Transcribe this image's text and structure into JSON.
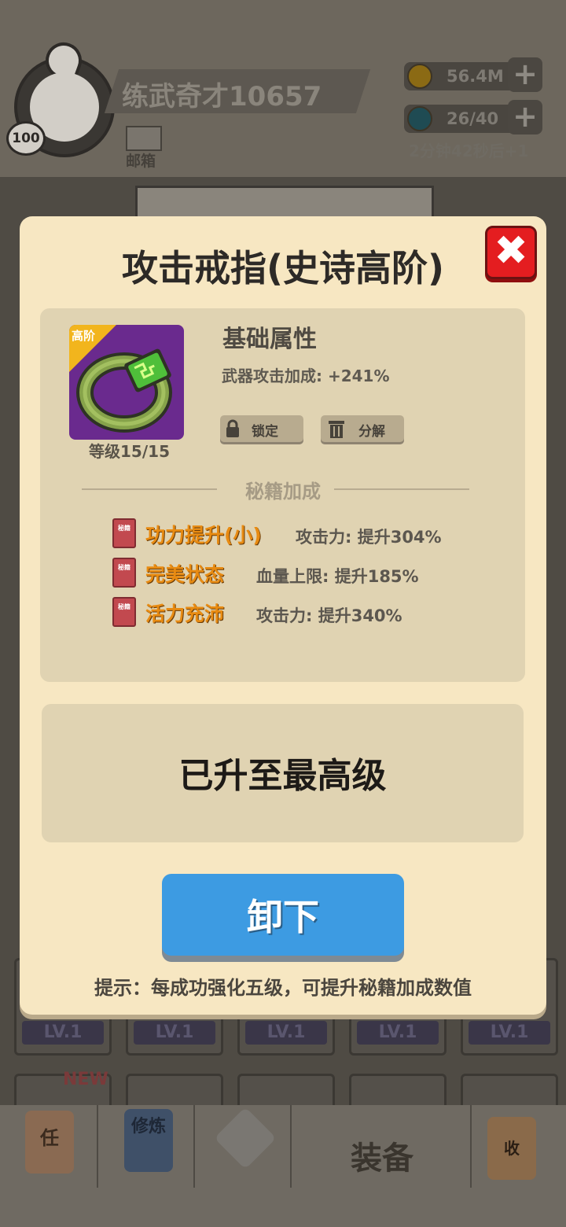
{
  "colors": {
    "modal_bg": "#f7e7c2",
    "panel_bg": "#e0d3b2",
    "accent_orange": "#e88b12",
    "button_blue": "#3d9be2",
    "close_red": "#e41d20",
    "item_purple": "#6a2a8e",
    "tier_gold": "#f2b51d"
  },
  "background": {
    "player_name": "练武奇才10657",
    "player_level": "100",
    "mail_label": "邮箱",
    "coins": "56.4M",
    "stamina": "26/40",
    "stamina_timer": "2分钟42秒后+1",
    "slot_lv": "LV.1",
    "new_tag": "NEW",
    "nav": {
      "task": "任",
      "cultivate": "修炼",
      "equip": "装备",
      "collect": "收"
    }
  },
  "modal": {
    "title": "攻击戒指(史诗高阶)",
    "close_icon": "close-x-icon",
    "item": {
      "icon": "ring-icon",
      "tier_tag": "高阶",
      "level": "等级15/15"
    },
    "base": {
      "title": "基础属性",
      "stat": "武器攻击加成: +241%"
    },
    "buttons": {
      "lock": "锁定",
      "decompose": "分解"
    },
    "secret_title": "秘籍加成",
    "book_icon_text": "秘籍",
    "skills": [
      {
        "name": "功力提升(小)",
        "effect": "攻击力: 提升304%"
      },
      {
        "name": "完美状态",
        "effect": "血量上限: 提升185%"
      },
      {
        "name": "活力充沛",
        "effect": "攻击力: 提升340%"
      }
    ],
    "max_level": "已升至最高级",
    "unequip": "卸下",
    "tip": "提示：每成功强化五级，可提升秘籍加成数值"
  }
}
